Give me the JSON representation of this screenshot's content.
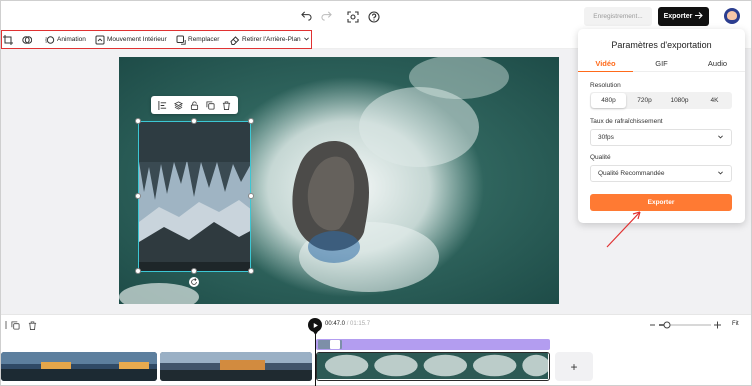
{
  "topbar": {
    "saving_label": "Enregistrement...",
    "export_label": "Exporter",
    "icons": [
      "undo-icon",
      "redo-icon",
      "screenshot-icon",
      "help-icon",
      "arrow-right-icon"
    ]
  },
  "toolbar": {
    "animation": "Animation",
    "motion": "Mouvement Intérieur",
    "replace": "Remplacer",
    "remove_bg": "Retirer l'Arrière-Plan"
  },
  "export_panel": {
    "title": "Paramètres d'exportation",
    "tabs": [
      "Vidéo",
      "GIF",
      "Audio"
    ],
    "active_tab": "Vidéo",
    "resolution_label": "Resolution",
    "resolutions": [
      "480p",
      "720p",
      "1080p",
      "4K"
    ],
    "active_resolution": "480p",
    "framerate_label": "Taux de rafraîchissement",
    "framerate_value": "30fps",
    "quality_label": "Qualité",
    "quality_value": "Qualité Recommandée",
    "export_label": "Exporter"
  },
  "timeline": {
    "current_time": "00:47.0",
    "separator": " / ",
    "total_time": "01:15.7",
    "fit_label": "Fit",
    "zoom_level": 0.15
  },
  "colors": {
    "accent": "#ff7a33",
    "selection": "#3cc7d4",
    "overlay_track": "#b39df0",
    "highlight": "#e03232"
  }
}
